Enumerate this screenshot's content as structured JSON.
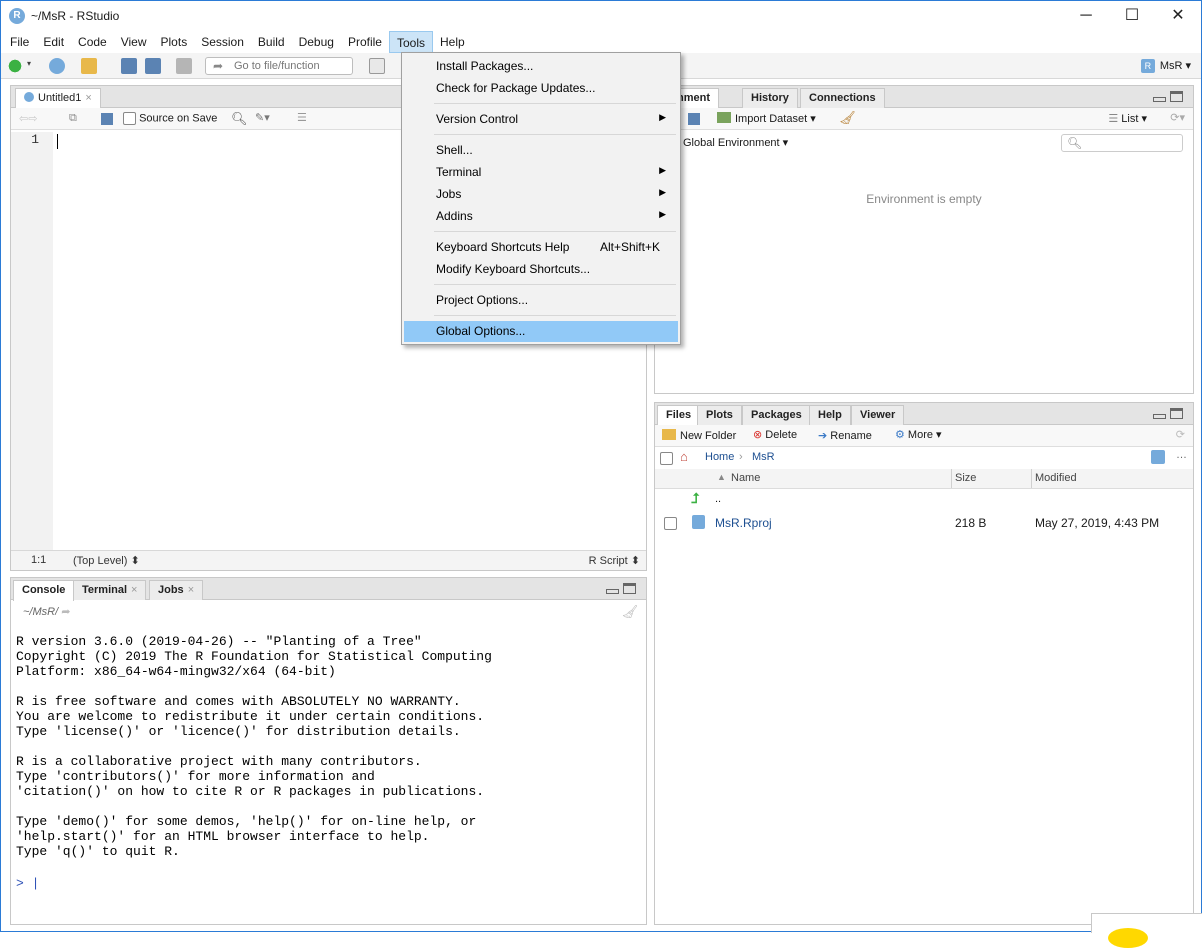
{
  "window": {
    "title": "~/MsR - RStudio",
    "app_icon": "R",
    "controls": {
      "minimize": "─",
      "maximize": "☐",
      "close": "✕"
    }
  },
  "menubar": [
    "File",
    "Edit",
    "Code",
    "View",
    "Plots",
    "Session",
    "Build",
    "Debug",
    "Profile",
    "Tools",
    "Help"
  ],
  "toolbar": {
    "goto_placeholder": "Go to file/function",
    "project": "MsR",
    "project_icon": "R"
  },
  "tools_menu": {
    "items": [
      {
        "label": "Install Packages..."
      },
      {
        "label": "Check for Package Updates..."
      },
      {
        "label": "Version Control",
        "submenu": true
      },
      {
        "label": "Shell..."
      },
      {
        "label": "Terminal",
        "submenu": true
      },
      {
        "label": "Jobs",
        "submenu": true
      },
      {
        "label": "Addins",
        "submenu": true
      },
      {
        "label": "Keyboard Shortcuts Help",
        "shortcut": "Alt+Shift+K"
      },
      {
        "label": "Modify Keyboard Shortcuts..."
      },
      {
        "label": "Project Options..."
      },
      {
        "label": "Global Options...",
        "highlighted": true
      }
    ],
    "submenu_glyph": "▶"
  },
  "editor": {
    "tab": "Untitled1",
    "tab_close": "×",
    "source_on_save": "Source on Save",
    "line_numbers": [
      "1"
    ],
    "position": "1:1",
    "scope": "(Top Level) ⬍",
    "filetype": "R Script ⬍"
  },
  "console_pane": {
    "tabs": [
      "Console",
      "Terminal",
      "Jobs"
    ],
    "tab_close": "×",
    "path": "~/MsR/",
    "lines": [
      "R version 3.6.0 (2019-04-26) -- \"Planting of a Tree\"",
      "Copyright (C) 2019 The R Foundation for Statistical Computing",
      "Platform: x86_64-w64-mingw32/x64 (64-bit)",
      "",
      "R is free software and comes with ABSOLUTELY NO WARRANTY.",
      "You are welcome to redistribute it under certain conditions.",
      "Type 'license()' or 'licence()' for distribution details.",
      "",
      "R is a collaborative project with many contributors.",
      "Type 'contributors()' for more information and",
      "'citation()' on how to cite R or R packages in publications.",
      "",
      "Type 'demo()' for some demos, 'help()' for on-line help, or",
      "'help.start()' for an HTML browser interface to help.",
      "Type 'q()' to quit R."
    ],
    "prompt": "> |"
  },
  "env_pane": {
    "tabs": [
      "Environment",
      "History",
      "Connections"
    ],
    "tab_visible_label": "ironment",
    "import_dataset": "Import Dataset",
    "list_mode": "List",
    "scope": "Global Environment",
    "empty_message": "Environment is empty"
  },
  "files_pane": {
    "tabs": [
      "Files",
      "Plots",
      "Packages",
      "Help",
      "Viewer"
    ],
    "actions": {
      "new_folder": "New Folder",
      "delete": "Delete",
      "rename": "Rename",
      "more": "More"
    },
    "breadcrumb": [
      "Home",
      "MsR"
    ],
    "columns": {
      "name": "Name",
      "size": "Size",
      "modified": "Modified"
    },
    "rows": [
      {
        "name": "..",
        "size": "",
        "modified": ""
      },
      {
        "name": "MsR.Rproj",
        "size": "218 B",
        "modified": "May 27, 2019, 4:43 PM"
      }
    ]
  },
  "colors": {
    "menu_highlight": "#91c9f7",
    "r_blue": "#75aadb",
    "link": "#1d4f91"
  }
}
